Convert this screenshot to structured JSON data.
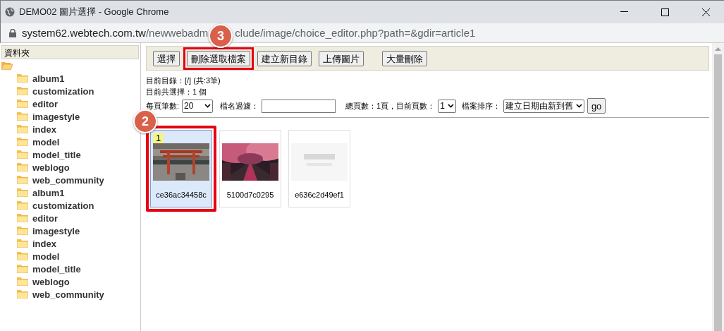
{
  "window": {
    "title": "DEMO02 圖片選擇 - Google Chrome",
    "url_host": "system62.webtech.com.tw",
    "url_path": "/newwebadm",
    "url_rest": "clude/image/choice_editor.php?path=&gdir=article1"
  },
  "sidebar": {
    "title": "資料夾",
    "tree": [
      {
        "expanded": true,
        "children": [
          {
            "label": "album1"
          },
          {
            "label": "customization"
          },
          {
            "label": "editor"
          },
          {
            "label": "imagestyle"
          },
          {
            "label": "index"
          },
          {
            "label": "model"
          },
          {
            "label": "model_title"
          },
          {
            "label": "weblogo"
          },
          {
            "label": "web_community"
          },
          {
            "label": "album1"
          },
          {
            "label": "customization"
          },
          {
            "label": "editor"
          },
          {
            "label": "imagestyle"
          },
          {
            "label": "index"
          },
          {
            "label": "model"
          },
          {
            "label": "model_title"
          },
          {
            "label": "weblogo"
          },
          {
            "label": "web_community"
          }
        ]
      }
    ]
  },
  "toolbar": [
    {
      "label": "選擇",
      "highlighted": false
    },
    {
      "label": "刪除選取檔案",
      "highlighted": true
    },
    {
      "label": "建立新目錄",
      "highlighted": false
    },
    {
      "label": "上傳圖片",
      "highlighted": false
    },
    {
      "label": "大量刪除",
      "highlighted": false
    }
  ],
  "info": [
    "目前目錄：[/] (共:3筆)",
    "目前共選擇：1 個"
  ],
  "controls": {
    "per_page_label": "每頁筆數:",
    "per_page": "20",
    "filter_label": "檔名過濾：",
    "pages_text": "總頁數：1頁，目前頁數：",
    "page": "1",
    "sort_label": "檔案排序：",
    "sort": "建立日期由新到舊",
    "go": "go"
  },
  "thumbnails": [
    {
      "name": "ce36ac34458c",
      "selected": true,
      "badge": "1",
      "kind": "torii",
      "highlighted": true
    },
    {
      "name": "5100d7c0295",
      "selected": false,
      "kind": "blossom",
      "highlighted": false
    },
    {
      "name": "e636c2d49ef1",
      "selected": false,
      "kind": "placeholder",
      "highlighted": false
    }
  ],
  "annotations": [
    {
      "label": "3"
    },
    {
      "label": "2"
    }
  ]
}
